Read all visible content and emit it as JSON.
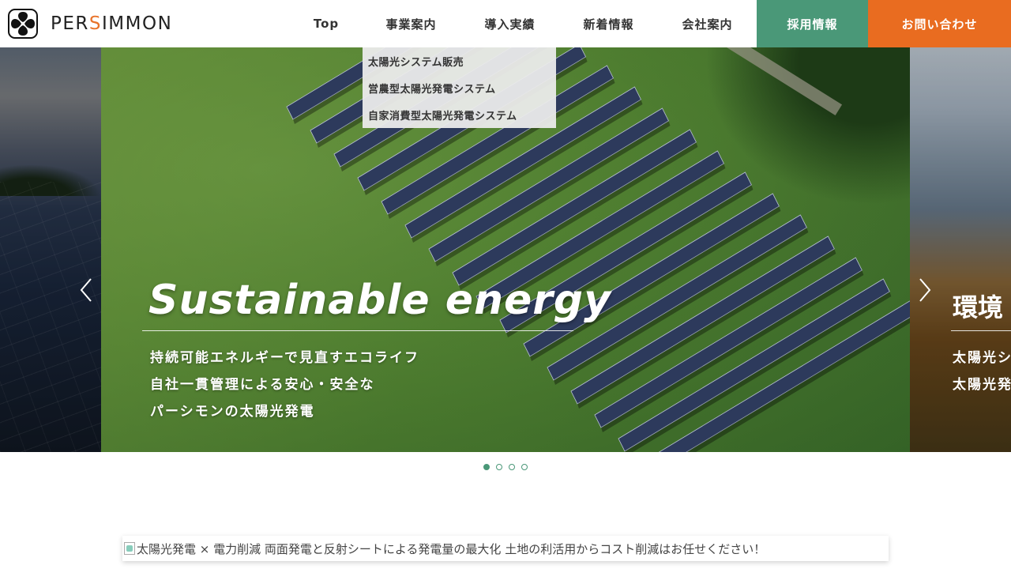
{
  "brand": {
    "logo_text_pre": "PER",
    "logo_text_s": "S",
    "logo_text_post": "IMMON"
  },
  "nav": {
    "top": "Top",
    "business": "事業案内",
    "results": "導入実績",
    "news": "新着情報",
    "company": "会社案内",
    "recruit": "採用情報",
    "contact": "お問い合わせ"
  },
  "dropdown": {
    "items": [
      "太陽光システム販売",
      "営農型太陽光発電システム",
      "自家消費型太陽光発電システム"
    ]
  },
  "hero": {
    "title": "Sustainable energy",
    "line1": "持続可能エネルギーで見直すエコライフ",
    "line2": "自社一貫管理による安心・安全な",
    "line3": "パーシモンの太陽光発電"
  },
  "next_slide": {
    "title": "環境",
    "line1": "太陽光シ",
    "line2": "太陽光発"
  },
  "slider": {
    "total_slides": 4,
    "active_index": 0
  },
  "banner": {
    "alt_text": "太陽光発電 × 電力削減 両面発電と反射シートによる発電量の最大化 土地の利活用からコスト削減はお任せください！"
  },
  "colors": {
    "accent_green": "#4a9878",
    "accent_orange": "#e96c20",
    "logo_s": "#e8732a"
  }
}
